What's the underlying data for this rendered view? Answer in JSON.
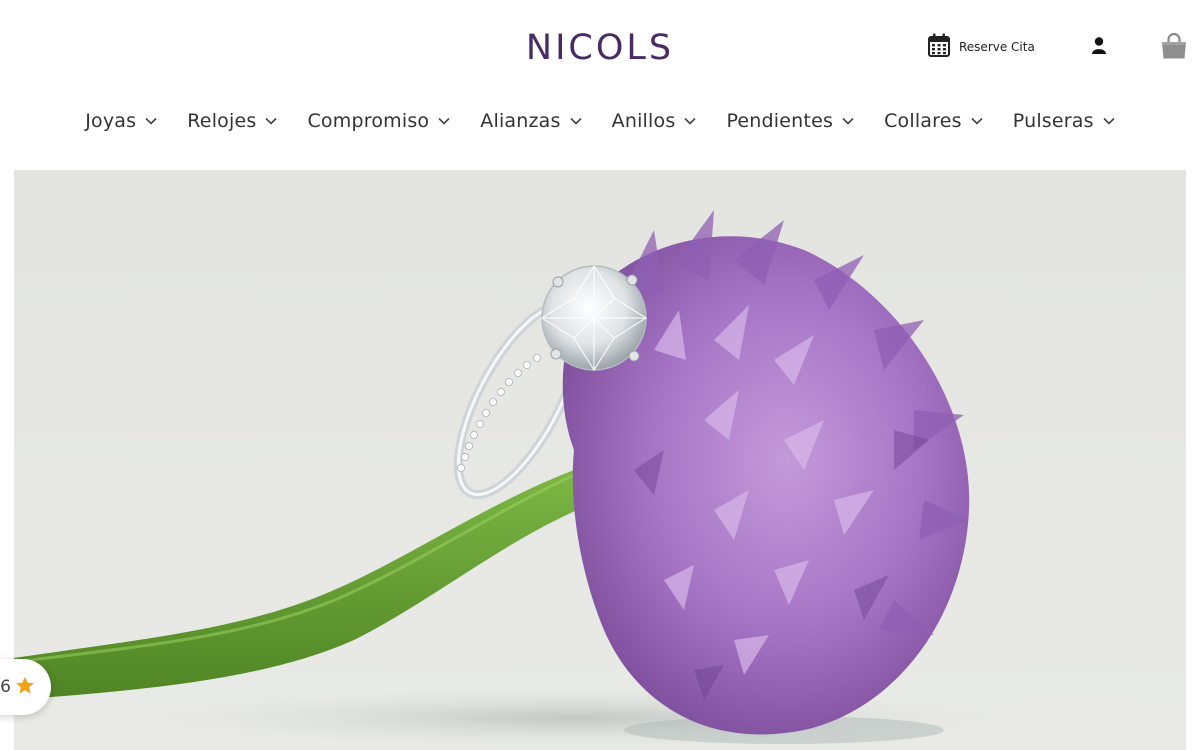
{
  "header": {
    "brand": "NICOLS",
    "appointment_label": "Reserve Cita",
    "icons": {
      "appointment": "calendar-icon",
      "account": "user-icon",
      "cart": "shopping-bag-icon"
    }
  },
  "nav": {
    "items": [
      {
        "label": "Joyas"
      },
      {
        "label": "Relojes"
      },
      {
        "label": "Compromiso"
      },
      {
        "label": "Alianzas"
      },
      {
        "label": "Anillos"
      },
      {
        "label": "Pendientes"
      },
      {
        "label": "Collares"
      },
      {
        "label": "Pulseras"
      }
    ],
    "dropdown_icon": "chevron-down-icon"
  },
  "rating_badge": {
    "value": "6",
    "icon": "star-icon",
    "star_color": "#f2a21b"
  },
  "colors": {
    "brand": "#4a2a66",
    "nav_text": "#333333",
    "hero_background": "#e5e6e2",
    "flower": "#a673c7",
    "stem": "#5f9a2e"
  }
}
